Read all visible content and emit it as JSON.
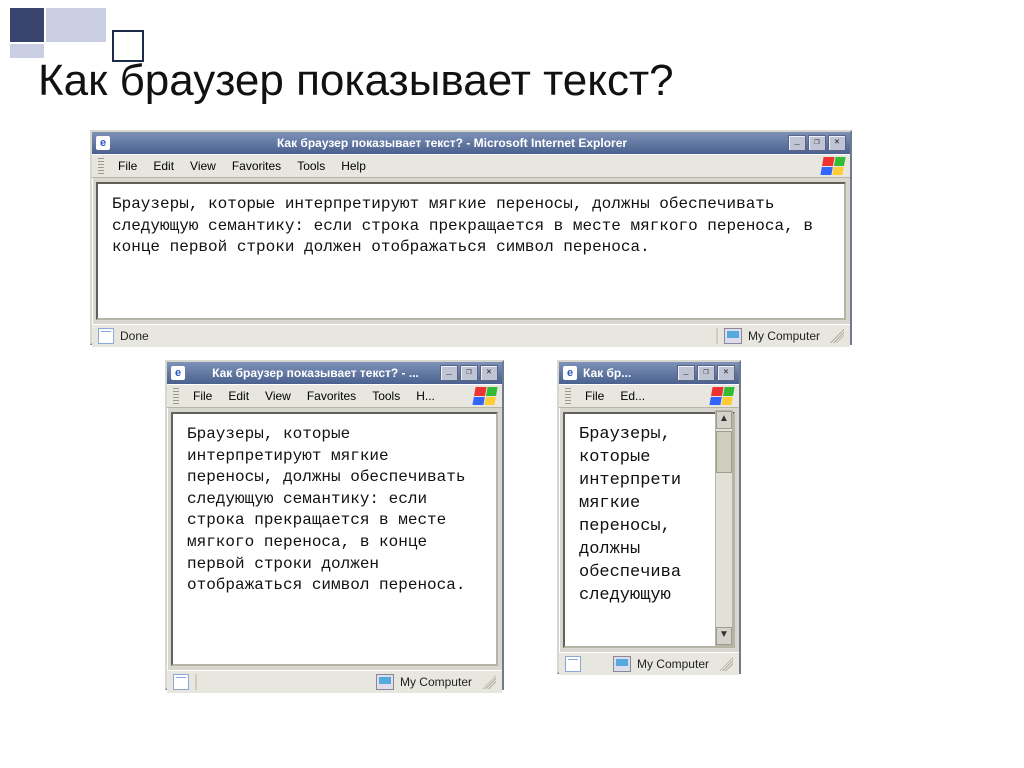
{
  "slide_title": "Как браузер показывает текст?",
  "windows": {
    "large": {
      "title": "Как браузер показывает текст? - Microsoft Internet Explorer",
      "menus": [
        "File",
        "Edit",
        "View",
        "Favorites",
        "Tools",
        "Help"
      ],
      "body": "Браузеры, которые интерпретируют мягкие переносы, должны обеспечивать следующую семантику: если строка прекращается в месте мягкого переноса, в конце первой строки должен отображаться символ переноса.",
      "status_left": "Done",
      "status_right": "My Computer"
    },
    "medium": {
      "title": "Как браузер показывает текст? - ...",
      "menus": [
        "File",
        "Edit",
        "View",
        "Favorites",
        "Tools",
        "H..."
      ],
      "body": "Браузеры, которые интерпретируют мягкие переносы, должны обеспечивать следующую семантику: если строка прекращается в месте мягкого переноса, в конце первой строки должен отображаться символ переноса.",
      "status_right": "My Computer"
    },
    "small": {
      "title": "Как бр...",
      "menus": [
        "File",
        "Ed..."
      ],
      "body_lines": [
        "Браузеры,",
        "которые",
        "интерпрети",
        "мягкие",
        "переносы,",
        "должны",
        "обеспечива",
        "следующую"
      ],
      "status_right": "My Computer"
    }
  },
  "win_controls": {
    "min": "_",
    "max": "❐",
    "close": "✕"
  }
}
